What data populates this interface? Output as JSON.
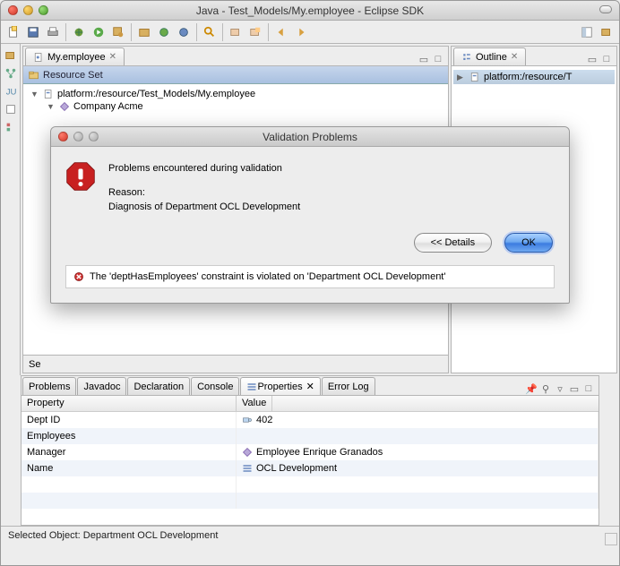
{
  "window": {
    "title": "Java - Test_Models/My.employee - Eclipse SDK"
  },
  "editor": {
    "tab_label": "My.employee",
    "header": "Resource Set",
    "tree": {
      "root": "platform:/resource/Test_Models/My.employee",
      "child": "Company Acme"
    },
    "se_label": "Se"
  },
  "outline": {
    "tab_label": "Outline",
    "row": "platform:/resource/T"
  },
  "bottom": {
    "tabs": [
      "Problems",
      "Javadoc",
      "Declaration",
      "Console",
      "Properties",
      "Error Log"
    ],
    "active": 4,
    "col_property": "Property",
    "col_value": "Value",
    "rows": [
      {
        "name": "Dept ID",
        "value": "402",
        "icon": "tag"
      },
      {
        "name": "Employees",
        "value": "",
        "icon": ""
      },
      {
        "name": "Manager",
        "value": "Employee Enrique Granados",
        "icon": "diamond"
      },
      {
        "name": "Name",
        "value": "OCL Development",
        "icon": "list"
      }
    ]
  },
  "status": "Selected Object: Department OCL Development",
  "dialog": {
    "title": "Validation Problems",
    "heading": "Problems encountered during validation",
    "reason_label": "Reason:",
    "reason_text": "Diagnosis of Department OCL Development",
    "details_btn": "<< Details",
    "ok_btn": "OK",
    "detail_row": "The 'deptHasEmployees' constraint is violated on 'Department OCL Development'"
  }
}
